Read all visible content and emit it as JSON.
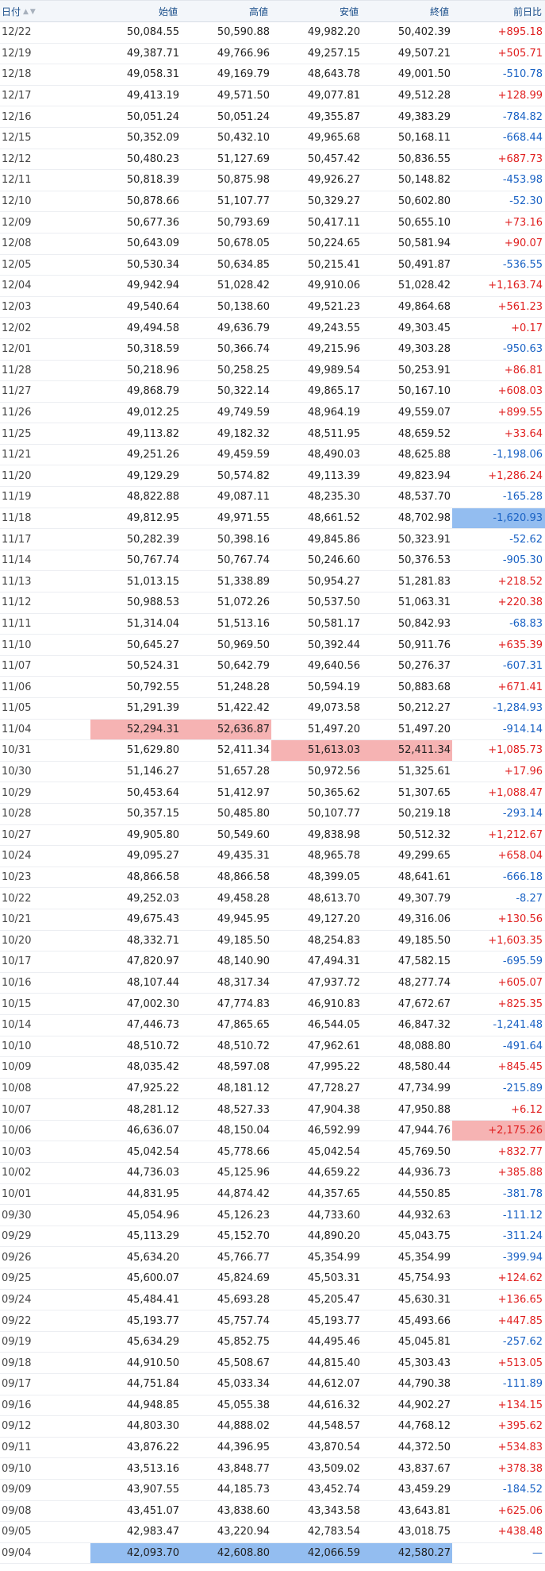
{
  "table": {
    "headers": {
      "date": "日付",
      "open": "始値",
      "high": "高値",
      "low": "安値",
      "close": "終値",
      "change": "前日比"
    },
    "rows": [
      {
        "date": "12/22",
        "open": "50,084.55",
        "high": "50,590.88",
        "low": "49,982.20",
        "close": "50,402.39",
        "change": "+895.18"
      },
      {
        "date": "12/19",
        "open": "49,387.71",
        "high": "49,766.96",
        "low": "49,257.15",
        "close": "49,507.21",
        "change": "+505.71"
      },
      {
        "date": "12/18",
        "open": "49,058.31",
        "high": "49,169.79",
        "low": "48,643.78",
        "close": "49,001.50",
        "change": "-510.78"
      },
      {
        "date": "12/17",
        "open": "49,413.19",
        "high": "49,571.50",
        "low": "49,077.81",
        "close": "49,512.28",
        "change": "+128.99"
      },
      {
        "date": "12/16",
        "open": "50,051.24",
        "high": "50,051.24",
        "low": "49,355.87",
        "close": "49,383.29",
        "change": "-784.82"
      },
      {
        "date": "12/15",
        "open": "50,352.09",
        "high": "50,432.10",
        "low": "49,965.68",
        "close": "50,168.11",
        "change": "-668.44"
      },
      {
        "date": "12/12",
        "open": "50,480.23",
        "high": "51,127.69",
        "low": "50,457.42",
        "close": "50,836.55",
        "change": "+687.73"
      },
      {
        "date": "12/11",
        "open": "50,818.39",
        "high": "50,875.98",
        "low": "49,926.27",
        "close": "50,148.82",
        "change": "-453.98"
      },
      {
        "date": "12/10",
        "open": "50,878.66",
        "high": "51,107.77",
        "low": "50,329.27",
        "close": "50,602.80",
        "change": "-52.30"
      },
      {
        "date": "12/09",
        "open": "50,677.36",
        "high": "50,793.69",
        "low": "50,417.11",
        "close": "50,655.10",
        "change": "+73.16"
      },
      {
        "date": "12/08",
        "open": "50,643.09",
        "high": "50,678.05",
        "low": "50,224.65",
        "close": "50,581.94",
        "change": "+90.07"
      },
      {
        "date": "12/05",
        "open": "50,530.34",
        "high": "50,634.85",
        "low": "50,215.41",
        "close": "50,491.87",
        "change": "-536.55"
      },
      {
        "date": "12/04",
        "open": "49,942.94",
        "high": "51,028.42",
        "low": "49,910.06",
        "close": "51,028.42",
        "change": "+1,163.74"
      },
      {
        "date": "12/03",
        "open": "49,540.64",
        "high": "50,138.60",
        "low": "49,521.23",
        "close": "49,864.68",
        "change": "+561.23"
      },
      {
        "date": "12/02",
        "open": "49,494.58",
        "high": "49,636.79",
        "low": "49,243.55",
        "close": "49,303.45",
        "change": "+0.17"
      },
      {
        "date": "12/01",
        "open": "50,318.59",
        "high": "50,366.74",
        "low": "49,215.96",
        "close": "49,303.28",
        "change": "-950.63"
      },
      {
        "date": "11/28",
        "open": "50,218.96",
        "high": "50,258.25",
        "low": "49,989.54",
        "close": "50,253.91",
        "change": "+86.81"
      },
      {
        "date": "11/27",
        "open": "49,868.79",
        "high": "50,322.14",
        "low": "49,865.17",
        "close": "50,167.10",
        "change": "+608.03"
      },
      {
        "date": "11/26",
        "open": "49,012.25",
        "high": "49,749.59",
        "low": "48,964.19",
        "close": "49,559.07",
        "change": "+899.55"
      },
      {
        "date": "11/25",
        "open": "49,113.82",
        "high": "49,182.32",
        "low": "48,511.95",
        "close": "48,659.52",
        "change": "+33.64"
      },
      {
        "date": "11/21",
        "open": "49,251.26",
        "high": "49,459.59",
        "low": "48,490.03",
        "close": "48,625.88",
        "change": "-1,198.06"
      },
      {
        "date": "11/20",
        "open": "49,129.29",
        "high": "50,574.82",
        "low": "49,113.39",
        "close": "49,823.94",
        "change": "+1,286.24"
      },
      {
        "date": "11/19",
        "open": "48,822.88",
        "high": "49,087.11",
        "low": "48,235.30",
        "close": "48,537.70",
        "change": "-165.28"
      },
      {
        "date": "11/18",
        "open": "49,812.95",
        "high": "49,971.55",
        "low": "48,661.52",
        "close": "48,702.98",
        "change": "-1,620.93",
        "hl": {
          "change": "min"
        }
      },
      {
        "date": "11/17",
        "open": "50,282.39",
        "high": "50,398.16",
        "low": "49,845.86",
        "close": "50,323.91",
        "change": "-52.62"
      },
      {
        "date": "11/14",
        "open": "50,767.74",
        "high": "50,767.74",
        "low": "50,246.60",
        "close": "50,376.53",
        "change": "-905.30"
      },
      {
        "date": "11/13",
        "open": "51,013.15",
        "high": "51,338.89",
        "low": "50,954.27",
        "close": "51,281.83",
        "change": "+218.52"
      },
      {
        "date": "11/12",
        "open": "50,988.53",
        "high": "51,072.26",
        "low": "50,537.50",
        "close": "51,063.31",
        "change": "+220.38"
      },
      {
        "date": "11/11",
        "open": "51,314.04",
        "high": "51,513.16",
        "low": "50,581.17",
        "close": "50,842.93",
        "change": "-68.83"
      },
      {
        "date": "11/10",
        "open": "50,645.27",
        "high": "50,969.50",
        "low": "50,392.44",
        "close": "50,911.76",
        "change": "+635.39"
      },
      {
        "date": "11/07",
        "open": "50,524.31",
        "high": "50,642.79",
        "low": "49,640.56",
        "close": "50,276.37",
        "change": "-607.31"
      },
      {
        "date": "11/06",
        "open": "50,792.55",
        "high": "51,248.28",
        "low": "50,594.19",
        "close": "50,883.68",
        "change": "+671.41"
      },
      {
        "date": "11/05",
        "open": "51,291.39",
        "high": "51,422.42",
        "low": "49,073.58",
        "close": "50,212.27",
        "change": "-1,284.93"
      },
      {
        "date": "11/04",
        "open": "52,294.31",
        "high": "52,636.87",
        "low": "51,497.20",
        "close": "51,497.20",
        "change": "-914.14",
        "hl": {
          "open": "max",
          "high": "max"
        }
      },
      {
        "date": "10/31",
        "open": "51,629.80",
        "high": "52,411.34",
        "low": "51,613.03",
        "close": "52,411.34",
        "change": "+1,085.73",
        "hl": {
          "low": "max",
          "close": "max"
        }
      },
      {
        "date": "10/30",
        "open": "51,146.27",
        "high": "51,657.28",
        "low": "50,972.56",
        "close": "51,325.61",
        "change": "+17.96"
      },
      {
        "date": "10/29",
        "open": "50,453.64",
        "high": "51,412.97",
        "low": "50,365.62",
        "close": "51,307.65",
        "change": "+1,088.47"
      },
      {
        "date": "10/28",
        "open": "50,357.15",
        "high": "50,485.80",
        "low": "50,107.77",
        "close": "50,219.18",
        "change": "-293.14"
      },
      {
        "date": "10/27",
        "open": "49,905.80",
        "high": "50,549.60",
        "low": "49,838.98",
        "close": "50,512.32",
        "change": "+1,212.67"
      },
      {
        "date": "10/24",
        "open": "49,095.27",
        "high": "49,435.31",
        "low": "48,965.78",
        "close": "49,299.65",
        "change": "+658.04"
      },
      {
        "date": "10/23",
        "open": "48,866.58",
        "high": "48,866.58",
        "low": "48,399.05",
        "close": "48,641.61",
        "change": "-666.18"
      },
      {
        "date": "10/22",
        "open": "49,252.03",
        "high": "49,458.28",
        "low": "48,613.70",
        "close": "49,307.79",
        "change": "-8.27"
      },
      {
        "date": "10/21",
        "open": "49,675.43",
        "high": "49,945.95",
        "low": "49,127.20",
        "close": "49,316.06",
        "change": "+130.56"
      },
      {
        "date": "10/20",
        "open": "48,332.71",
        "high": "49,185.50",
        "low": "48,254.83",
        "close": "49,185.50",
        "change": "+1,603.35"
      },
      {
        "date": "10/17",
        "open": "47,820.97",
        "high": "48,140.90",
        "low": "47,494.31",
        "close": "47,582.15",
        "change": "-695.59"
      },
      {
        "date": "10/16",
        "open": "48,107.44",
        "high": "48,317.34",
        "low": "47,937.72",
        "close": "48,277.74",
        "change": "+605.07"
      },
      {
        "date": "10/15",
        "open": "47,002.30",
        "high": "47,774.83",
        "low": "46,910.83",
        "close": "47,672.67",
        "change": "+825.35"
      },
      {
        "date": "10/14",
        "open": "47,446.73",
        "high": "47,865.65",
        "low": "46,544.05",
        "close": "46,847.32",
        "change": "-1,241.48"
      },
      {
        "date": "10/10",
        "open": "48,510.72",
        "high": "48,510.72",
        "low": "47,962.61",
        "close": "48,088.80",
        "change": "-491.64"
      },
      {
        "date": "10/09",
        "open": "48,035.42",
        "high": "48,597.08",
        "low": "47,995.22",
        "close": "48,580.44",
        "change": "+845.45"
      },
      {
        "date": "10/08",
        "open": "47,925.22",
        "high": "48,181.12",
        "low": "47,728.27",
        "close": "47,734.99",
        "change": "-215.89"
      },
      {
        "date": "10/07",
        "open": "48,281.12",
        "high": "48,527.33",
        "low": "47,904.38",
        "close": "47,950.88",
        "change": "+6.12"
      },
      {
        "date": "10/06",
        "open": "46,636.07",
        "high": "48,150.04",
        "low": "46,592.99",
        "close": "47,944.76",
        "change": "+2,175.26",
        "hl": {
          "change": "max"
        }
      },
      {
        "date": "10/03",
        "open": "45,042.54",
        "high": "45,778.66",
        "low": "45,042.54",
        "close": "45,769.50",
        "change": "+832.77"
      },
      {
        "date": "10/02",
        "open": "44,736.03",
        "high": "45,125.96",
        "low": "44,659.22",
        "close": "44,936.73",
        "change": "+385.88"
      },
      {
        "date": "10/01",
        "open": "44,831.95",
        "high": "44,874.42",
        "low": "44,357.65",
        "close": "44,550.85",
        "change": "-381.78"
      },
      {
        "date": "09/30",
        "open": "45,054.96",
        "high": "45,126.23",
        "low": "44,733.60",
        "close": "44,932.63",
        "change": "-111.12"
      },
      {
        "date": "09/29",
        "open": "45,113.29",
        "high": "45,152.70",
        "low": "44,890.20",
        "close": "45,043.75",
        "change": "-311.24"
      },
      {
        "date": "09/26",
        "open": "45,634.20",
        "high": "45,766.77",
        "low": "45,354.99",
        "close": "45,354.99",
        "change": "-399.94"
      },
      {
        "date": "09/25",
        "open": "45,600.07",
        "high": "45,824.69",
        "low": "45,503.31",
        "close": "45,754.93",
        "change": "+124.62"
      },
      {
        "date": "09/24",
        "open": "45,484.41",
        "high": "45,693.28",
        "low": "45,205.47",
        "close": "45,630.31",
        "change": "+136.65"
      },
      {
        "date": "09/22",
        "open": "45,193.77",
        "high": "45,757.74",
        "low": "45,193.77",
        "close": "45,493.66",
        "change": "+447.85"
      },
      {
        "date": "09/19",
        "open": "45,634.29",
        "high": "45,852.75",
        "low": "44,495.46",
        "close": "45,045.81",
        "change": "-257.62"
      },
      {
        "date": "09/18",
        "open": "44,910.50",
        "high": "45,508.67",
        "low": "44,815.40",
        "close": "45,303.43",
        "change": "+513.05"
      },
      {
        "date": "09/17",
        "open": "44,751.84",
        "high": "45,033.34",
        "low": "44,612.07",
        "close": "44,790.38",
        "change": "-111.89"
      },
      {
        "date": "09/16",
        "open": "44,948.85",
        "high": "45,055.38",
        "low": "44,616.32",
        "close": "44,902.27",
        "change": "+134.15"
      },
      {
        "date": "09/12",
        "open": "44,803.30",
        "high": "44,888.02",
        "low": "44,548.57",
        "close": "44,768.12",
        "change": "+395.62"
      },
      {
        "date": "09/11",
        "open": "43,876.22",
        "high": "44,396.95",
        "low": "43,870.54",
        "close": "44,372.50",
        "change": "+534.83"
      },
      {
        "date": "09/10",
        "open": "43,513.16",
        "high": "43,848.77",
        "low": "43,509.02",
        "close": "43,837.67",
        "change": "+378.38"
      },
      {
        "date": "09/09",
        "open": "43,907.55",
        "high": "44,185.73",
        "low": "43,452.74",
        "close": "43,459.29",
        "change": "-184.52"
      },
      {
        "date": "09/08",
        "open": "43,451.07",
        "high": "43,838.60",
        "low": "43,343.58",
        "close": "43,643.81",
        "change": "+625.06"
      },
      {
        "date": "09/05",
        "open": "42,983.47",
        "high": "43,220.94",
        "low": "42,783.54",
        "close": "43,018.75",
        "change": "+438.48"
      },
      {
        "date": "09/04",
        "open": "42,093.70",
        "high": "42,608.80",
        "low": "42,066.59",
        "close": "42,580.27",
        "change": "—",
        "hl": {
          "open": "min",
          "high": "min",
          "low": "min",
          "close": "min"
        }
      }
    ]
  },
  "colors": {
    "up": "#e02020",
    "down": "#1a62c4",
    "highlight_max": "#f6b3b3",
    "highlight_min": "#93bdf0",
    "header_text": "#1a4e8a",
    "header_bg": "#f3f6fa"
  },
  "icons": {
    "sort": "sort-arrows-icon"
  }
}
